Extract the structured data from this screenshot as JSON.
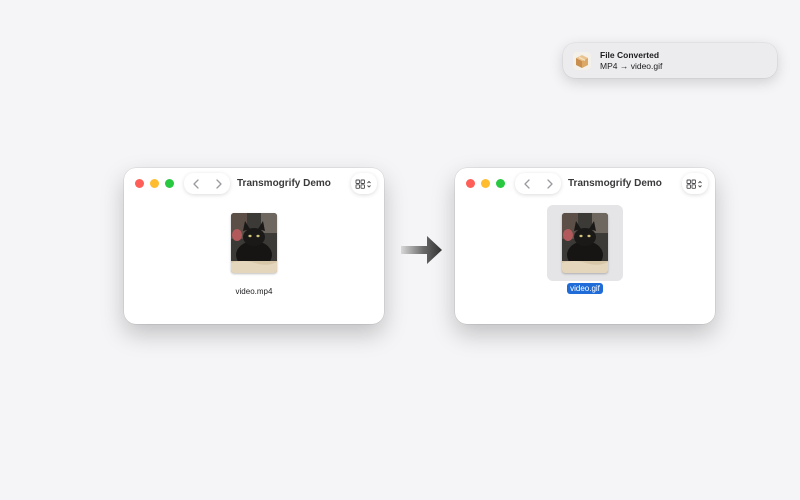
{
  "notification": {
    "title": "File Converted",
    "body": "MP4 → video.gif",
    "icon": "package-icon"
  },
  "windows": [
    {
      "title": "Transmogrify Demo",
      "file": {
        "name": "video.mp4",
        "selected": false
      }
    },
    {
      "title": "Transmogrify Demo",
      "file": {
        "name": "video.gif",
        "selected": true
      }
    }
  ],
  "colors": {
    "close": "#ff5f57",
    "minimize": "#febc2e",
    "zoom": "#28c840",
    "selection": "#1f6cd9"
  }
}
